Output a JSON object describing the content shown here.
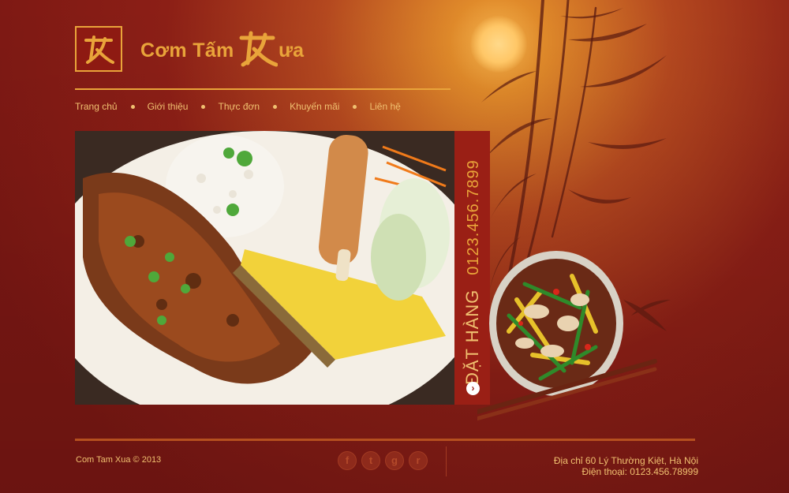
{
  "brand": {
    "name_part1": "Cơm Tấm",
    "name_part2": "ưa",
    "logo_glyph": "X-calligraphy-logo"
  },
  "nav": {
    "items": [
      {
        "label": "Trang chủ"
      },
      {
        "label": "Giới thiệu"
      },
      {
        "label": "Thực đơn"
      },
      {
        "label": "Khuyến mãi"
      },
      {
        "label": "Liên hệ"
      }
    ]
  },
  "hero": {
    "photo_alt": "com-tam-dish-photo"
  },
  "order": {
    "label": "ĐẶT HÀNG",
    "phone": "0123.456.7899",
    "button_icon": "chevron-right-icon"
  },
  "footer": {
    "copyright": "Com Tam Xua © 2013",
    "social": [
      "f",
      "t",
      "g",
      "r"
    ],
    "address": "Địa chỉ 60 Lý Thường Kiệt, Hà Nội",
    "phone": "Điện thoại: 0123.456.78999"
  },
  "colors": {
    "accent": "#e9a43a",
    "background": "#8c1f16",
    "panel": "#9a1f15"
  }
}
